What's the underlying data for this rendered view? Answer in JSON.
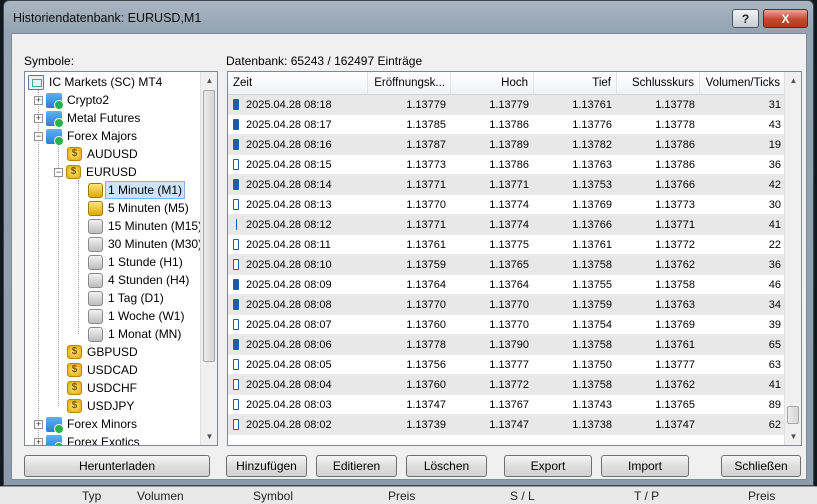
{
  "window": {
    "title": "Historiendatenbank: EURUSD,M1",
    "help_label": "?",
    "close_label": "X"
  },
  "symbols_label": "Symbole:",
  "database_label": "Datenbank: 65243 / 162497 Einträge",
  "tree": {
    "root": "IC Markets (SC) MT4",
    "crypto": "Crypto2",
    "metal": "Metal Futures",
    "forex_majors": "Forex Majors",
    "audusd": "AUDUSD",
    "eurusd": "EURUSD",
    "tf_m1": "1 Minute (M1)",
    "tf_m5": "5 Minuten (M5)",
    "tf_m15": "15 Minuten (M15)",
    "tf_m30": "30 Minuten (M30)",
    "tf_h1": "1 Stunde (H1)",
    "tf_h4": "4 Stunden (H4)",
    "tf_d1": "1 Tag (D1)",
    "tf_w1": "1 Woche (W1)",
    "tf_mn": "1 Monat (MN)",
    "gbpusd": "GBPUSD",
    "usdcad": "USDCAD",
    "usdchf": "USDCHF",
    "usdjpy": "USDJPY",
    "forex_minors": "Forex Minors",
    "forex_exotics": "Forex Exotics",
    "coin_glyph": "$"
  },
  "columns": [
    "Zeit",
    "Eröffnungsk...",
    "Hoch",
    "Tief",
    "Schlusskurs",
    "Volumen/Ticks"
  ],
  "rows": [
    [
      "2025.04.28 08:18",
      "1.13779",
      "1.13779",
      "1.13761",
      "1.13778",
      "31"
    ],
    [
      "2025.04.28 08:17",
      "1.13785",
      "1.13786",
      "1.13776",
      "1.13778",
      "43"
    ],
    [
      "2025.04.28 08:16",
      "1.13787",
      "1.13789",
      "1.13782",
      "1.13786",
      "19"
    ],
    [
      "2025.04.28 08:15",
      "1.13773",
      "1.13786",
      "1.13763",
      "1.13786",
      "36"
    ],
    [
      "2025.04.28 08:14",
      "1.13771",
      "1.13771",
      "1.13753",
      "1.13766",
      "42"
    ],
    [
      "2025.04.28 08:13",
      "1.13770",
      "1.13774",
      "1.13769",
      "1.13773",
      "30"
    ],
    [
      "2025.04.28 08:12",
      "1.13771",
      "1.13774",
      "1.13766",
      "1.13771",
      "41"
    ],
    [
      "2025.04.28 08:11",
      "1.13761",
      "1.13775",
      "1.13761",
      "1.13772",
      "22"
    ],
    [
      "2025.04.28 08:10",
      "1.13759",
      "1.13765",
      "1.13758",
      "1.13762",
      "36"
    ],
    [
      "2025.04.28 08:09",
      "1.13764",
      "1.13764",
      "1.13755",
      "1.13758",
      "46"
    ],
    [
      "2025.04.28 08:08",
      "1.13770",
      "1.13770",
      "1.13759",
      "1.13763",
      "34"
    ],
    [
      "2025.04.28 08:07",
      "1.13760",
      "1.13770",
      "1.13754",
      "1.13769",
      "39"
    ],
    [
      "2025.04.28 08:06",
      "1.13778",
      "1.13790",
      "1.13758",
      "1.13761",
      "65"
    ],
    [
      "2025.04.28 08:05",
      "1.13756",
      "1.13777",
      "1.13750",
      "1.13777",
      "63"
    ],
    [
      "2025.04.28 08:04",
      "1.13760",
      "1.13772",
      "1.13758",
      "1.13762",
      "41"
    ],
    [
      "2025.04.28 08:03",
      "1.13747",
      "1.13767",
      "1.13743",
      "1.13765",
      "89"
    ],
    [
      "2025.04.28 08:02",
      "1.13739",
      "1.13747",
      "1.13738",
      "1.13747",
      "62"
    ]
  ],
  "buttons": {
    "download": "Herunterladen",
    "add": "Hinzufügen",
    "edit": "Editieren",
    "delete": "Löschen",
    "export": "Export",
    "import": "Import",
    "close": "Schließen"
  },
  "background_columns": [
    "Typ",
    "Volumen",
    "Symbol",
    "Preis",
    "S / L",
    "T / P",
    "Preis"
  ],
  "colors": {
    "selection": "#cde4f7",
    "candle": "#1e5aa8",
    "row_alt": "#e8e8e8"
  }
}
